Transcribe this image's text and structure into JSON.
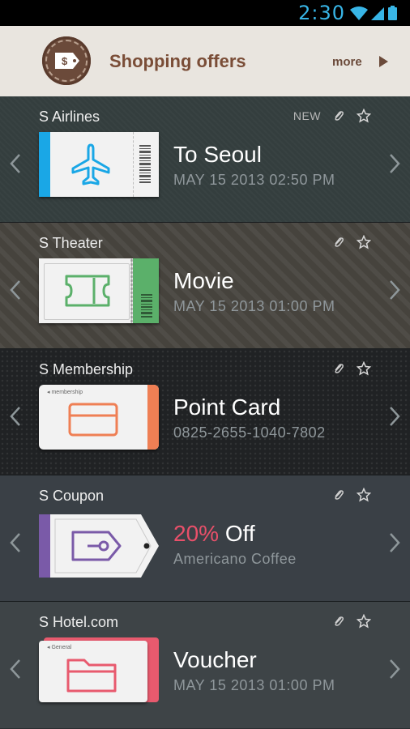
{
  "status": {
    "time": "2:30"
  },
  "header": {
    "title": "Shopping offers",
    "more": "more"
  },
  "cards": [
    {
      "name": "S Airlines",
      "badge": "NEW",
      "title": "To Seoul",
      "subtitle": "MAY 15 2013 02:50 PM",
      "accent": "#1aa7e6",
      "icon": "airplane-icon"
    },
    {
      "name": "S Theater",
      "title": "Movie",
      "subtitle": "MAY 15 2013 01:00 PM",
      "accent": "#5bb06a",
      "icon": "ticket-icon"
    },
    {
      "name": "S Membership",
      "tag": "membership",
      "title": "Point Card",
      "subtitle": "0825-2655-1040-7802",
      "accent": "#ef7f54",
      "icon": "card-icon"
    },
    {
      "name": "S Coupon",
      "title_highlight": "20%",
      "title": "Off",
      "subtitle": "Americano Coffee",
      "accent": "#7a5aa8",
      "icon": "price-tag-icon"
    },
    {
      "name": "S Hotel.com",
      "tag": "General",
      "title": "Voucher",
      "subtitle": "MAY 15 2013 01:00 PM",
      "accent": "#e85a6e",
      "icon": "folder-icon"
    }
  ]
}
